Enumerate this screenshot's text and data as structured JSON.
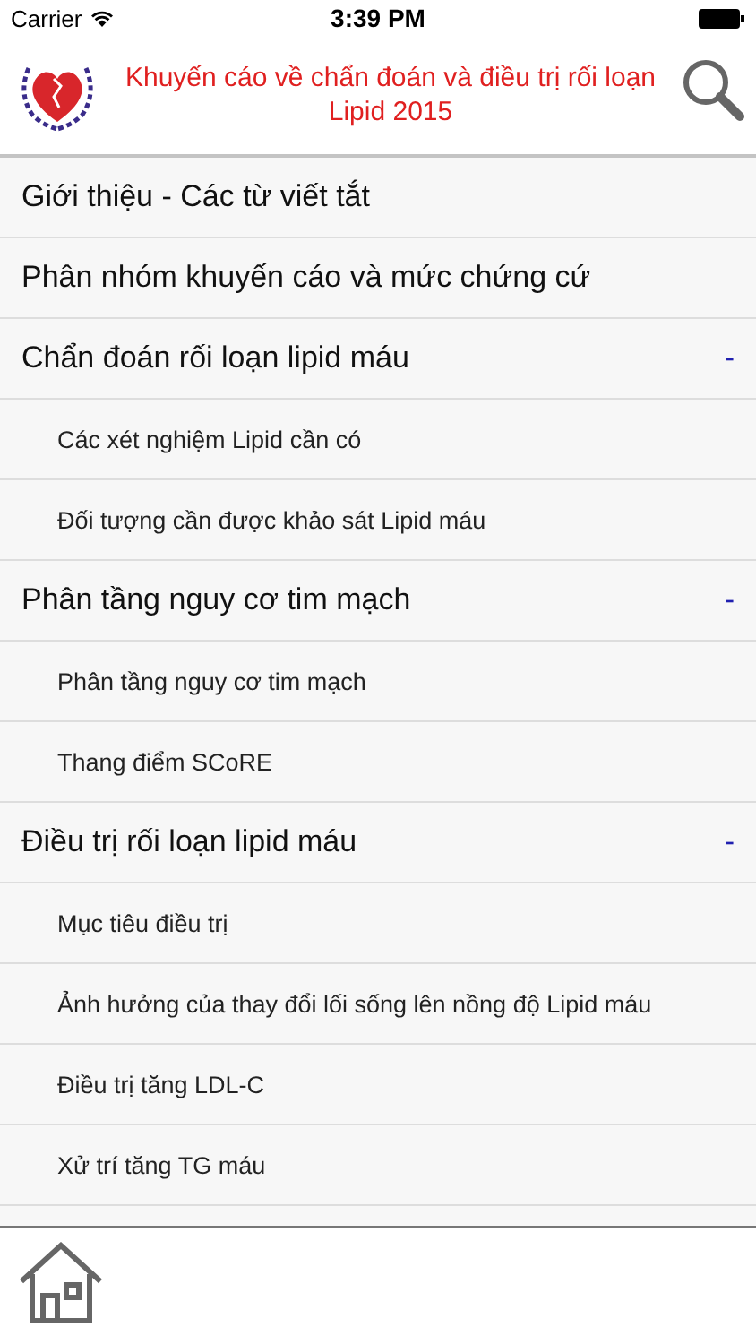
{
  "status_bar": {
    "carrier": "Carrier",
    "time": "3:39 PM"
  },
  "header": {
    "title": "Khuyến cáo về chẩn đoán và điều trị rối loạn Lipid 2015"
  },
  "sections": [
    {
      "kind": "leaf",
      "title": "Giới thiệu - Các từ viết tắt"
    },
    {
      "kind": "leaf",
      "title": "Phân nhóm khuyến cáo và mức chứng cứ"
    },
    {
      "kind": "group",
      "title": "Chẩn đoán rối loạn lipid máu",
      "expanded": true,
      "toggle": "-",
      "children": [
        {
          "title": "Các xét nghiệm Lipid cần có"
        },
        {
          "title": "Đối tượng cần được khảo sát Lipid máu"
        }
      ]
    },
    {
      "kind": "group",
      "title": "Phân tầng nguy cơ tim mạch",
      "expanded": true,
      "toggle": "-",
      "children": [
        {
          "title": "Phân tầng nguy cơ tim mạch"
        },
        {
          "title": "Thang điểm SCoRE"
        }
      ]
    },
    {
      "kind": "group",
      "title": "Điều trị rối loạn lipid máu",
      "expanded": true,
      "toggle": "-",
      "children": [
        {
          "title": "Mục tiêu điều trị"
        },
        {
          "title": "Ảnh hưởng của thay đổi lối sống lên nồng độ Lipid máu"
        },
        {
          "title": "Điều trị tăng LDL-C"
        },
        {
          "title": "Xử trí tăng TG máu"
        }
      ]
    }
  ]
}
